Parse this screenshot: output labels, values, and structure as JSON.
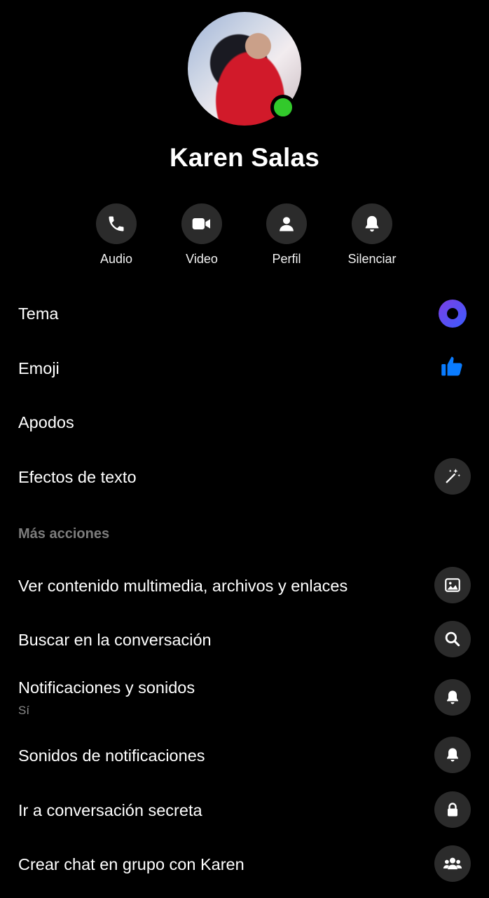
{
  "profile": {
    "name": "Karen Salas",
    "online_color": "#32c92b"
  },
  "actions": [
    {
      "label": "Audio",
      "icon": "phone-icon"
    },
    {
      "label": "Video",
      "icon": "video-camera-icon"
    },
    {
      "label": "Perfil",
      "icon": "person-icon"
    },
    {
      "label": "Silenciar",
      "icon": "bell-icon"
    }
  ],
  "settings": {
    "theme": {
      "label": "Tema",
      "icon": "theme-circle-icon",
      "colors": [
        "#7b3fe4",
        "#3b5cff"
      ]
    },
    "emoji": {
      "label": "Emoji",
      "icon": "thumbs-up-icon",
      "color": "#0a7cff"
    },
    "nicknames": {
      "label": "Apodos"
    },
    "text_effects": {
      "label": "Efectos de texto",
      "icon": "magic-wand-icon"
    }
  },
  "more_actions": {
    "title": "Más acciones",
    "items": [
      {
        "label": "Ver contenido multimedia, archivos y enlaces",
        "icon": "image-icon"
      },
      {
        "label": "Buscar en la conversación",
        "icon": "search-icon"
      },
      {
        "label": "Notificaciones y sonidos",
        "sublabel": "Sí",
        "icon": "bell-icon"
      },
      {
        "label": "Sonidos de notificaciones",
        "icon": "bell-icon"
      },
      {
        "label": "Ir a conversación secreta",
        "icon": "lock-icon"
      },
      {
        "label": "Crear chat en grupo con Karen",
        "icon": "group-icon"
      }
    ]
  }
}
